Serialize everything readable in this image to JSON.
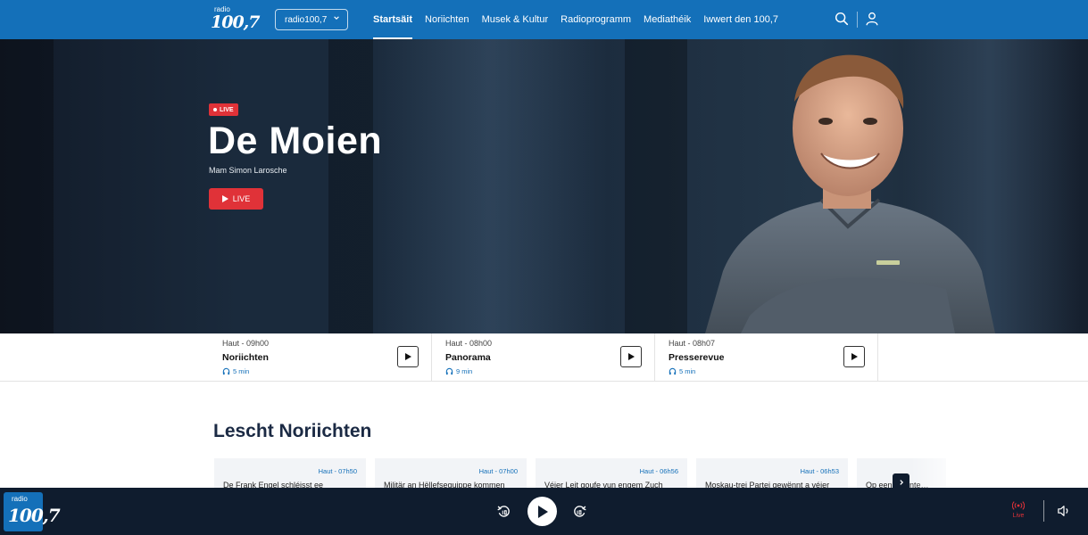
{
  "header": {
    "logo": {
      "small": "radio",
      "big": "100,7"
    },
    "station_select": "radio100,7",
    "nav": [
      {
        "label": "Startsäit",
        "active": true
      },
      {
        "label": "Noriichten",
        "active": false
      },
      {
        "label": "Musek & Kultur",
        "active": false
      },
      {
        "label": "Radioprogramm",
        "active": false
      },
      {
        "label": "Mediathéik",
        "active": false
      },
      {
        "label": "Iwwert den 100,7",
        "active": false
      }
    ],
    "icons": {
      "search": "search-icon",
      "account": "user-icon"
    }
  },
  "hero": {
    "tag": "LIVE",
    "title": "De Moien",
    "host": "Mam Simon Larosche",
    "button": "LIVE"
  },
  "episodes": [
    {
      "meta": "Haut - 09h00",
      "title": "Noriichten",
      "duration": "5 min"
    },
    {
      "meta": "Haut - 08h00",
      "title": "Panorama",
      "duration": "9 min"
    },
    {
      "meta": "Haut - 08h07",
      "title": "Presserevue",
      "duration": "5 min"
    }
  ],
  "news": {
    "title": "Lescht Noriichten",
    "cards": [
      {
        "time": "Haut - 07h50",
        "headline": "De Frank Engel schléisst ee"
      },
      {
        "time": "Haut - 07h00",
        "headline": "Militär an Hëllefsequippe kommen"
      },
      {
        "time": "Haut - 06h56",
        "headline": "Véier Leit goufe vun engem Zuch"
      },
      {
        "time": "Haut - 06h53",
        "headline": "Moskau-trei Partei gewënnt a véier"
      },
      {
        "time": "",
        "headline": "Op een… ronte…"
      }
    ]
  },
  "player": {
    "logo": {
      "small": "radio",
      "big": "100,7"
    },
    "live_label": "Live"
  },
  "colors": {
    "brand_blue": "#1470b9",
    "live_red": "#e03238",
    "player_dark": "#0f1c2e"
  }
}
